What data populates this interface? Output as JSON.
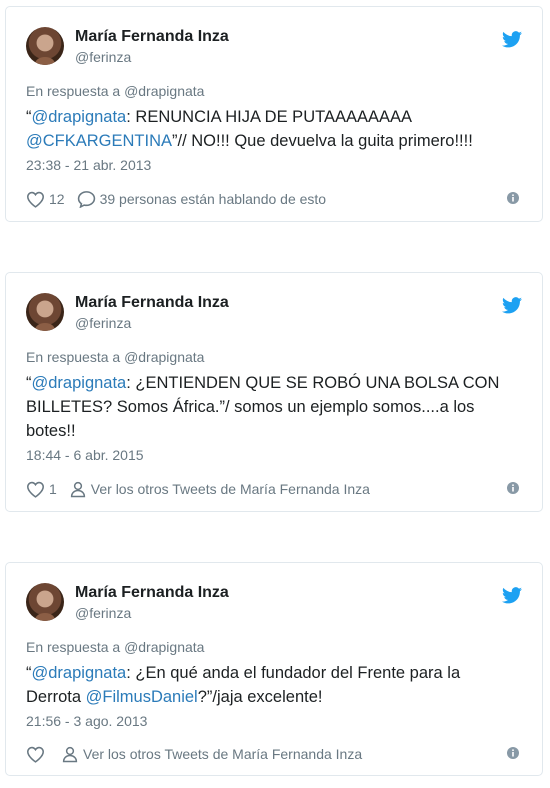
{
  "tweets": [
    {
      "name": "María Fernanda Inza",
      "handle": "@ferinza",
      "reply_prefix": "En respuesta a",
      "reply_to": "@drapignata",
      "text_parts": [
        "“",
        "@drapignata",
        ": RENUNCIA HIJA DE PUTAAAAAAAA ",
        "@CFKARGENTINA",
        "”// NO!!! Que devuelva la guita primero!!!!"
      ],
      "date": "23:38 - 21 abr. 2013",
      "like_count": "12",
      "action_label": "39 personas están hablando de esto",
      "action_icon": "comment-icon"
    },
    {
      "name": "María Fernanda Inza",
      "handle": "@ferinza",
      "reply_prefix": "En respuesta a",
      "reply_to": "@drapignata",
      "text_parts": [
        "“",
        "@drapignata",
        ": ¿ENTIENDEN QUE SE ROBÓ UNA BOLSA CON BILLETES? Somos África.”/ somos un ejemplo somos....a los botes!!"
      ],
      "date": "18:44 - 6 abr. 2015",
      "like_count": "1",
      "action_label": "Ver los otros Tweets de María Fernanda Inza",
      "action_icon": "person-icon"
    },
    {
      "name": "María Fernanda Inza",
      "handle": "@ferinza",
      "reply_prefix": "En respuesta a",
      "reply_to": "@drapignata",
      "text_parts": [
        "“",
        "@drapignata",
        ": ¿En qué anda el fundador del Frente para la Derrota ",
        "@FilmusDaniel",
        "?”/jaja excelente!"
      ],
      "date": "21:56 - 3 ago. 2013",
      "like_count": "",
      "action_label": "Ver los otros Tweets de María Fernanda Inza",
      "action_icon": "person-icon"
    }
  ],
  "colors": {
    "link": "#2b7bb9",
    "muted": "#697882",
    "twitter_blue": "#1da1f2",
    "border": "#e1e8ed"
  }
}
